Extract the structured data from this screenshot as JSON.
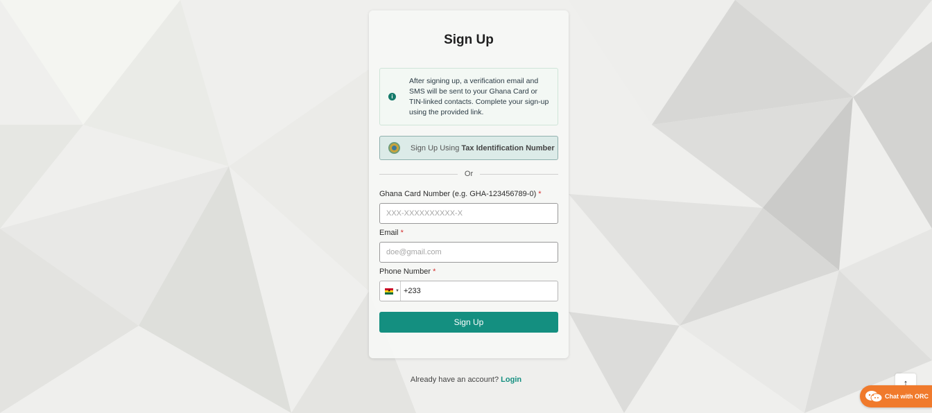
{
  "page": {
    "title": "Sign Up",
    "info_text": "After signing up, a verification email and SMS will be sent to your Ghana Card or TIN-linked contacts. Complete your sign-up using the provided link.",
    "tin_button": {
      "prefix": "Sign Up Using ",
      "bold": "Tax Identification Number"
    },
    "divider_text": "Or",
    "ghana_card": {
      "label": "Ghana Card Number (e.g. GHA-123456789-0)",
      "required_mark": "*",
      "placeholder": "XXX-XXXXXXXXXX-X",
      "value": ""
    },
    "email": {
      "label": "Email",
      "required_mark": "*",
      "placeholder": "doe@gmail.com",
      "value": ""
    },
    "phone": {
      "label": "Phone Number",
      "required_mark": "*",
      "value": "+233",
      "country_flag": "Ghana"
    },
    "submit_label": "Sign Up",
    "footer": {
      "text": "Already have an account? ",
      "link": "Login"
    }
  },
  "widgets": {
    "scroll_top_icon": "arrow-up-icon",
    "scroll_top_glyph": "↑",
    "chat_label": "Chat with ORC"
  },
  "colors": {
    "accent": "#148f80",
    "chat": "#f07a2c",
    "required": "#d42f2f"
  }
}
